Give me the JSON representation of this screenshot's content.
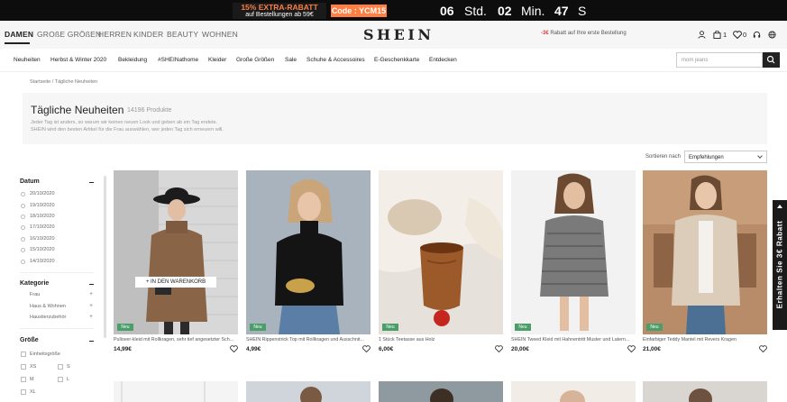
{
  "promo": {
    "line1": "15% EXTRA-RABATT",
    "line2": "auf Bestellungen ab 59€",
    "code": "Code : YCM15",
    "countdown": [
      {
        "value": "06",
        "unit": "Std."
      },
      {
        "value": "02",
        "unit": "Min."
      },
      {
        "value": "47",
        "unit": "S"
      }
    ]
  },
  "header": {
    "categories": [
      "DAMEN",
      "GROßE GRÖßEN",
      "HERREN",
      "KINDER",
      "BEAUTY",
      "WOHNEN"
    ],
    "logo": "SHEIN",
    "shipping_highlight": "-3€",
    "shipping_text": "Rabatt auf Ihre erste Bestellung",
    "bag_count": "1",
    "wishlist_count": "0",
    "icons": [
      "user-icon",
      "bag-icon",
      "heart-icon",
      "headset-icon",
      "globe-icon"
    ]
  },
  "nav": {
    "items": [
      "Neuheiten",
      "Herbst & Winter 2020",
      "Bekleidung",
      "#SHEINathome",
      "Kleider",
      "Große Größen",
      "Sale",
      "Schuhe & Accessoires",
      "E-Geschenkkarte",
      "Entdecken"
    ],
    "search_placeholder": "mom jeans"
  },
  "breadcrumb": {
    "home": "Startseite",
    "sep": "/",
    "current": "Tägliche Neuheiten"
  },
  "banner": {
    "title": "Tägliche Neuheiten",
    "count": "14196 Produkte",
    "desc1": "Jeder Tag ist anders, so warum wir keinen neuen Look und geben ab ein Tag endete.",
    "desc2": "SHEIN wird den besten Artikel für die Frau auswählen, wer jeden Tag sich erneuern will."
  },
  "sort": {
    "label": "Sortieren nach",
    "value": "Empfehlungen"
  },
  "filters": {
    "datum_title": "Datum",
    "dates": [
      "20/10/2020",
      "19/10/2020",
      "18/10/2020",
      "17/10/2020",
      "16/10/2020",
      "15/10/2020",
      "14/10/2020"
    ],
    "kategorie_title": "Kategorie",
    "categories": [
      "Frau",
      "Haus & Wohnen",
      "Haustierzubehör"
    ],
    "groesse_title": "Größe",
    "sizes": [
      "Einheitsgröße",
      "XS",
      "S",
      "M",
      "L",
      "XL"
    ]
  },
  "products": [
    {
      "title": "Pullover-kleid mit Rollkragen, sehr tief angesetzter Sch...",
      "price": "14,99€",
      "badge": "Neu",
      "cart_label": "+ IN DEN WARENKORB"
    },
    {
      "title": "SHEIN Rippenstrick Top mit Rollkragen und Ausschnit...",
      "price": "4,99€",
      "badge": "Neu"
    },
    {
      "title": "1 Stück Teetasse aus Holz",
      "price": "6,00€",
      "badge": "Neu"
    },
    {
      "title": "SHEIN Tweed Kleid mit Hahnentritt Muster und Latern...",
      "price": "20,00€",
      "badge": "Neu"
    },
    {
      "title": "Einfarbiger Teddy Mantel mit Revers Kragen",
      "price": "21,00€",
      "badge": "Neu"
    }
  ],
  "side_tab": {
    "label": "Erhalten Sie 3€ Rabatt"
  },
  "colors": {
    "accent_orange": "#ff7e42",
    "badge_green": "#4a9e6a",
    "shipping_red": "#d23f3f"
  }
}
